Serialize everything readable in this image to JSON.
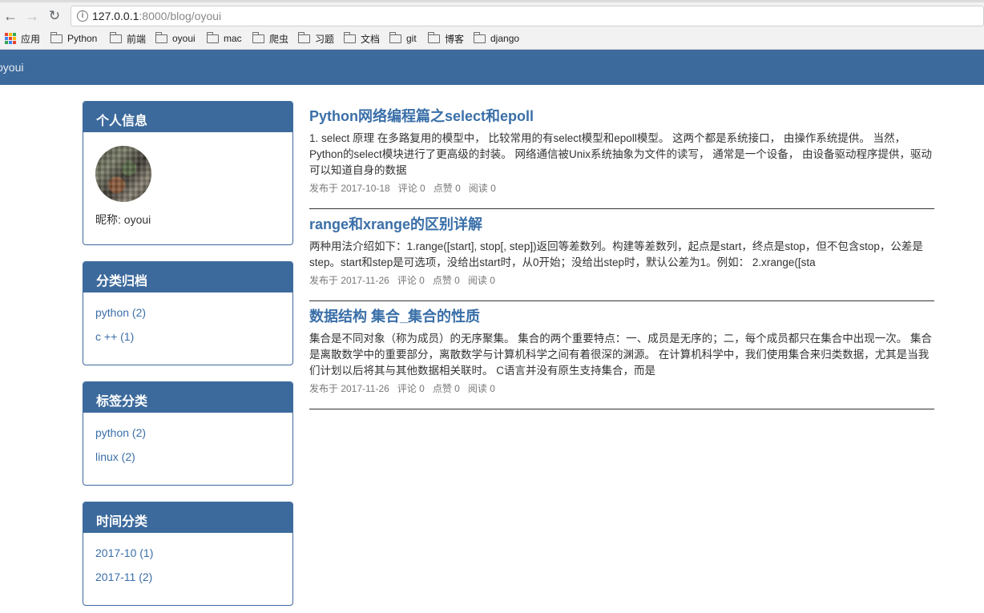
{
  "browser": {
    "url_host": "127.0.0.1",
    "url_rest": ":8000/blog/oyoui",
    "bookmarks": [
      {
        "label": "应用",
        "icon": "apps-icon"
      },
      {
        "label": "Python",
        "icon": "folder-icon"
      },
      {
        "label": "前端",
        "icon": "folder-icon"
      },
      {
        "label": "oyoui",
        "icon": "folder-icon"
      },
      {
        "label": "mac",
        "icon": "folder-icon"
      },
      {
        "label": "爬虫",
        "icon": "folder-icon"
      },
      {
        "label": "习题",
        "icon": "folder-icon"
      },
      {
        "label": "文档",
        "icon": "folder-icon"
      },
      {
        "label": "git",
        "icon": "folder-icon"
      },
      {
        "label": "博客",
        "icon": "folder-icon"
      },
      {
        "label": "django",
        "icon": "folder-icon"
      }
    ]
  },
  "site": {
    "brand": "oyoui",
    "accent_color": "#3c6a9c"
  },
  "sidebar": {
    "profile": {
      "title": "个人信息",
      "nickname": "昵称: oyoui"
    },
    "categories": {
      "title": "分类归档",
      "items": [
        "python (2)",
        "c ++ (1)"
      ]
    },
    "tags": {
      "title": "标签分类",
      "items": [
        "python (2)",
        "linux (2)"
      ]
    },
    "dates": {
      "title": "时间分类",
      "items": [
        "2017-10 (1)",
        "2017-11 (2)"
      ]
    }
  },
  "articles": [
    {
      "title": "Python网络编程篇之select和epoll",
      "desc": "1. select 原理 在多路复用的模型中， 比较常用的有select模型和epoll模型。 这两个都是系统接口， 由操作系统提供。 当然，Python的select模块进行了更高级的封装。 网络通信被Unix系统抽象为文件的读写， 通常是一个设备， 由设备驱动程序提供，驱动可以知道自身的数据",
      "date": "发布于 2017-10-18",
      "comments": "评论 0",
      "likes": "点赞 0",
      "reads": "阅读 0"
    },
    {
      "title": "range和xrange的区别详解",
      "desc": "两种用法介绍如下：1.range([start], stop[, step])返回等差数列。构建等差数列，起点是start，终点是stop，但不包含stop，公差是step。start和step是可选项，没给出start时，从0开始；没给出step时，默认公差为1。例如： 2.xrange([sta",
      "date": "发布于 2017-11-26",
      "comments": "评论 0",
      "likes": "点赞 0",
      "reads": "阅读 0"
    },
    {
      "title": "数据结构 集合_集合的性质",
      "desc": "集合是不同对象（称为成员）的无序聚集。 集合的两个重要特点：一、成员是无序的；二，每个成员都只在集合中出现一次。 集合是离散数学中的重要部分，离散数学与计算机科学之间有着很深的渊源。 在计算机科学中，我们使用集合来归类数据，尤其是当我们计划以后将其与其他数据相关联时。 C语言并没有原生支持集合，而是",
      "date": "发布于 2017-11-26",
      "comments": "评论 0",
      "likes": "点赞 0",
      "reads": "阅读 0"
    }
  ]
}
